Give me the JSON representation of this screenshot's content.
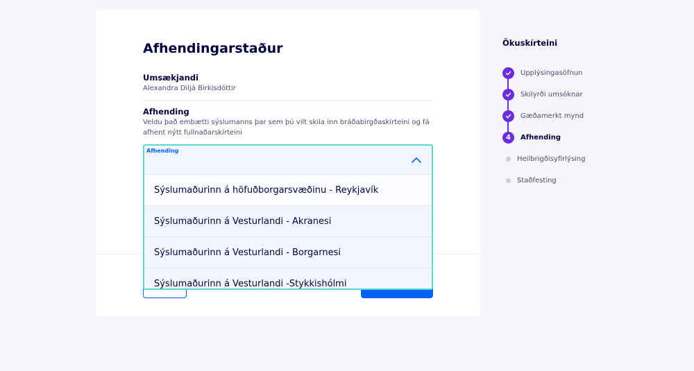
{
  "form": {
    "title": "Afhendingarstaður",
    "applicant": {
      "label": "Umsækjandi",
      "value": "Alexandra Diljá Birkisdóttir"
    },
    "delivery": {
      "label": "Afhending",
      "description": "Veldu það embætti sýslumanns þar sem þú vilt skila inn bráðabirgðaskírteini og fá afhent nýtt fullnaðarskírteini"
    },
    "select": {
      "label": "Afhending",
      "icon": "chevron-up-icon",
      "state": "open",
      "options": [
        "Sýslumaðurinn á höfuðborgarsvæðinu - Reykjavík",
        "Sýslumaðurinn á Vesturlandi - Akranesi",
        "Sýslumaðurinn á Vesturlandi - Borgarnesi",
        "Sýslumaðurinn á Vesturlandi -Stykkishólmi"
      ]
    }
  },
  "sidebar": {
    "title": "Ökuskírteini",
    "steps": [
      {
        "label": "Upplýsingasöfnun",
        "status": "done"
      },
      {
        "label": "Skilyrði umsóknar",
        "status": "done"
      },
      {
        "label": "Gæðamerkt mynd",
        "status": "done"
      },
      {
        "label": "Afhending",
        "status": "current",
        "number": "4"
      },
      {
        "label": "Heilbrigðisyfirlýsing",
        "status": "upcoming"
      },
      {
        "label": "Staðfesting",
        "status": "upcoming"
      }
    ]
  },
  "colors": {
    "accent": "#6a2edc",
    "primary": "#0061ff",
    "focus": "#57dcc8",
    "text": "#00003c"
  }
}
